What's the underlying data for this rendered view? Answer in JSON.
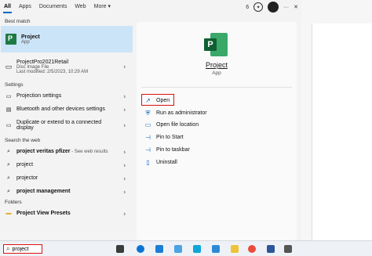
{
  "tabs": [
    "All",
    "Apps",
    "Documents",
    "Web",
    "More ▾"
  ],
  "tab_extras": {
    "count": "6",
    "more_options": "···",
    "close": "✕"
  },
  "best_match_header": "Best match",
  "best_match": {
    "title": "Project",
    "subtitle": "App"
  },
  "file_result": {
    "title": "ProjectPro2021Retail",
    "type": "Disc Image File",
    "modified": "Last modified: 2/5/2023, 10:29 AM"
  },
  "settings_header": "Settings",
  "settings": [
    {
      "label": "Projection settings"
    },
    {
      "label": "Bluetooth and other devices settings"
    },
    {
      "label_line1": "Duplicate or extend to a connected",
      "label_line2": "display"
    }
  ],
  "web_header": "Search the web",
  "web_results": [
    {
      "query": "project veritas pfizer",
      "suffix": " - See web results"
    },
    {
      "query": "project"
    },
    {
      "query": "projector"
    },
    {
      "query": "project management"
    }
  ],
  "folders_header": "Folders",
  "folders": [
    {
      "label": "Project View Presets"
    }
  ],
  "app_panel": {
    "title": "Project",
    "subtitle": "App",
    "actions": [
      "Open",
      "Run as administrator",
      "Open file location",
      "Pin to Start",
      "Pin to taskbar",
      "Uninstall"
    ]
  },
  "search": {
    "value": "project"
  },
  "colors": {
    "accent": "#0067c0",
    "highlight": "#cce4f7",
    "annotation_red": "#dd1111",
    "project_green": "#1e7a44"
  }
}
